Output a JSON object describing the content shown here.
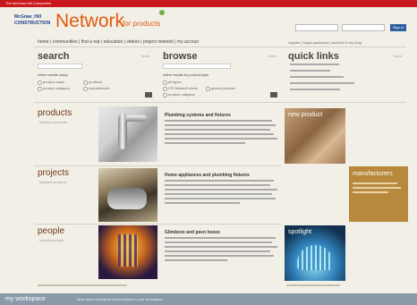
{
  "header": {
    "topbar_text": "The McGraw-Hill Companies",
    "logo_line1": "McGraw_Hill",
    "logo_line2": "CONSTRUCTION",
    "product_name": "Network",
    "product_suffix": "for products",
    "signin_label": "Sign in"
  },
  "nav": {
    "items": "home | communities | find a rep | education | videos | project network | my account"
  },
  "right_nav": {
    "text": "register | forgot password | add this to my blog"
  },
  "search": {
    "title": "search",
    "more_label": "more",
    "options_label": "refine results using",
    "options": [
      "product name",
      "products",
      "product category",
      "manufacturer"
    ]
  },
  "browse": {
    "title": "browse",
    "more_label": "more",
    "filter_label": "refine results by product type",
    "options": [
      "all types",
      "CSI MasterFormat",
      "green products",
      "product category"
    ]
  },
  "quick_links": {
    "title": "quick links",
    "more_label": "more"
  },
  "sections": [
    {
      "title": "products",
      "sub": "featured products",
      "article_title": "Plumbing systems and fixtures"
    },
    {
      "title": "projects",
      "sub": "featured projects",
      "article_title": "Home appliances and plumbing fixtures"
    },
    {
      "title": "people",
      "sub": "industry people",
      "article_title": "Glimboxx and peen boxes"
    }
  ],
  "right_panels": {
    "new_product": "new product",
    "manufacturers": "manufacturers",
    "spotlight": "spotlight"
  },
  "footer": {
    "left": "my workspace",
    "right": "keep track of projects and products in your workspace"
  },
  "colors": {
    "topbar": "#c8181c",
    "brand_orange": "#e05a12",
    "footer": "#8a9aa8",
    "manufacturers_tile": "#b8893c"
  }
}
